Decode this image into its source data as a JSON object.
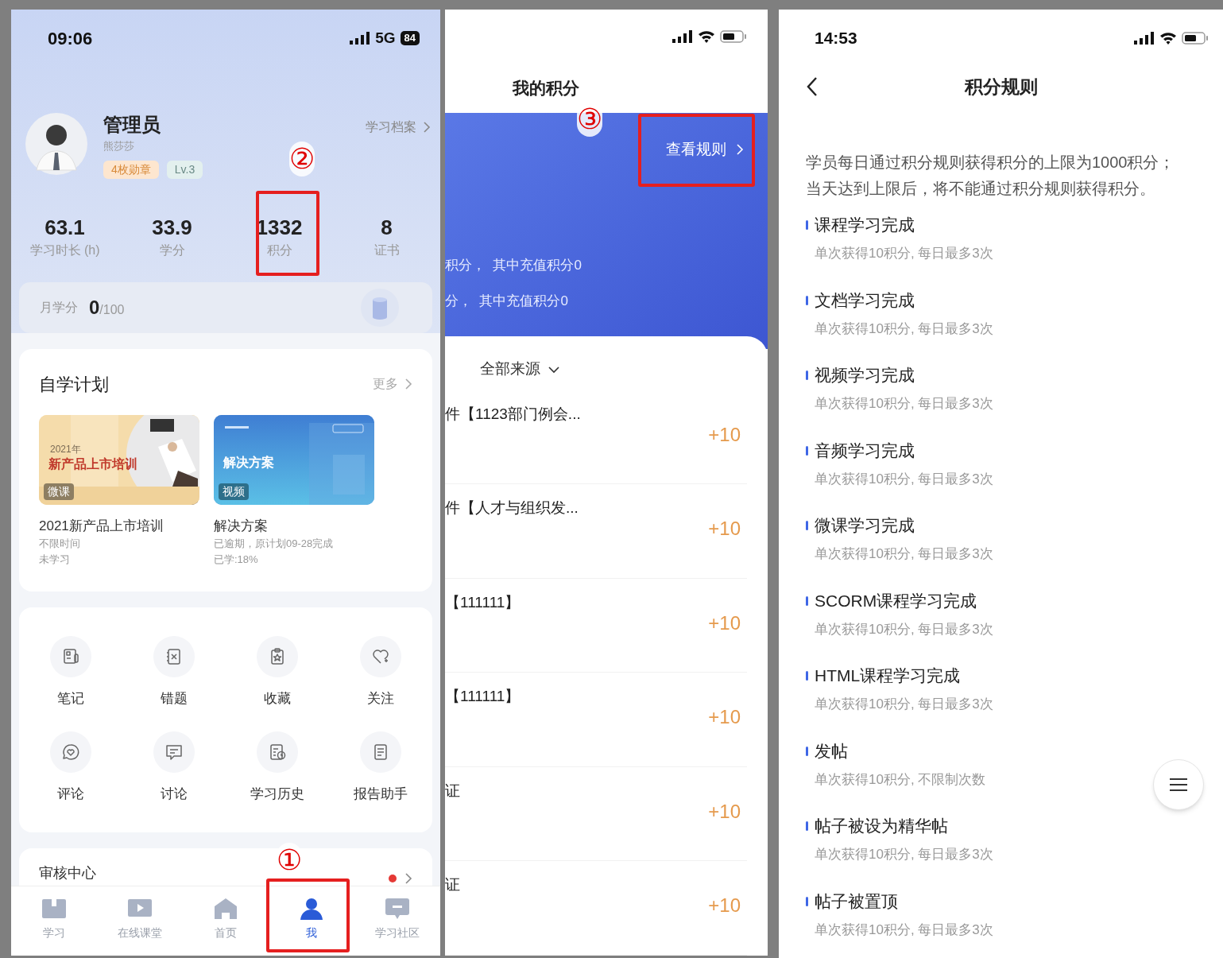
{
  "phone_me": {
    "status_bar": {
      "time": "09:06",
      "network": "5G",
      "battery": "84"
    },
    "profile": {
      "name": "管理员",
      "subtitle": "熊莎莎",
      "badges": [
        "4枚勋章",
        "Lv.3"
      ],
      "archive_link": "学习档案"
    },
    "stats": [
      {
        "value": "63.1",
        "label": "学习时长 (h)"
      },
      {
        "value": "33.9",
        "label": "学分"
      },
      {
        "value": "1332",
        "label": "积分"
      },
      {
        "value": "8",
        "label": "证书"
      }
    ],
    "monthly": {
      "label": "月学分",
      "value": "0",
      "total": "/100"
    },
    "plan": {
      "title": "自学计划",
      "more": "更多",
      "courses": [
        {
          "kind": "warm",
          "cover_year": "2021年",
          "cover_title": "新产品上市培训",
          "tag": "微课",
          "title": "2021新产品上市培训",
          "lines": [
            "不限时间",
            "未学习"
          ]
        },
        {
          "kind": "cool",
          "cover_title": "解决方案",
          "tag": "视频",
          "title": "解决方案",
          "lines": [
            "已逾期，原计划09-28完成",
            "已学:18%"
          ]
        }
      ]
    },
    "tools": [
      {
        "label": "笔记"
      },
      {
        "label": "错题"
      },
      {
        "label": "收藏"
      },
      {
        "label": "关注"
      },
      {
        "label": "评论"
      },
      {
        "label": "讨论"
      },
      {
        "label": "学习历史"
      },
      {
        "label": "报告助手"
      }
    ],
    "audit": {
      "title": "审核中心",
      "unread": true
    },
    "tab_bar": [
      {
        "label": "学习",
        "selected": false
      },
      {
        "label": "在线课堂",
        "selected": false
      },
      {
        "label": "首页",
        "selected": false
      },
      {
        "label": "我",
        "selected": true
      },
      {
        "label": "学习社区",
        "selected": false
      }
    ]
  },
  "phone_points": {
    "title": "我的积分",
    "rules_link": "查看规则",
    "summary_lines": [
      "积分，  其中充值积分0",
      "分，  其中充值积分0"
    ],
    "filter": "全部来源",
    "records": [
      {
        "title": "件【1123部门例会...",
        "points": "+10"
      },
      {
        "title": "件【人才与组织发...",
        "points": "+10"
      },
      {
        "title": "【111111】",
        "points": "+10"
      },
      {
        "title": "【111111】",
        "points": "+10"
      },
      {
        "title": "证",
        "points": "+10"
      },
      {
        "title": "证",
        "points": "+10"
      }
    ]
  },
  "phone_rules": {
    "time": "14:53",
    "title": "积分规则",
    "intro_lines": [
      "学员每日通过积分规则获得积分的上限为1000积分；",
      "当天达到上限后，将不能通过积分规则获得积分。"
    ],
    "rules": [
      {
        "title": "课程学习完成",
        "detail": "单次获得10积分, 每日最多3次"
      },
      {
        "title": "文档学习完成",
        "detail": "单次获得10积分, 每日最多3次"
      },
      {
        "title": "视频学习完成",
        "detail": "单次获得10积分, 每日最多3次"
      },
      {
        "title": "音频学习完成",
        "detail": "单次获得10积分, 每日最多3次"
      },
      {
        "title": "微课学习完成",
        "detail": "单次获得10积分, 每日最多3次"
      },
      {
        "title": "SCORM课程学习完成",
        "detail": "单次获得10积分, 每日最多3次"
      },
      {
        "title": "HTML课程学习完成",
        "detail": "单次获得10积分, 每日最多3次"
      },
      {
        "title": "发帖",
        "detail": "单次获得10积分, 不限制次数"
      },
      {
        "title": "帖子被设为精华帖",
        "detail": "单次获得10积分, 每日最多3次"
      },
      {
        "title": "帖子被置顶",
        "detail": "单次获得10积分, 每日最多3次"
      }
    ]
  },
  "annotations": [
    {
      "label": "②"
    },
    {
      "label": "①"
    },
    {
      "label": "③"
    }
  ]
}
